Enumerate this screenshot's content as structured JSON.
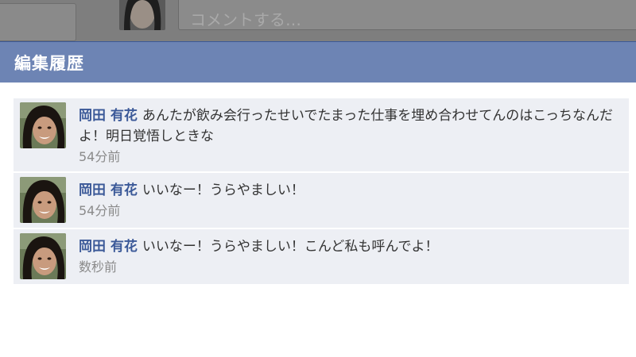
{
  "background": {
    "comment_placeholder": "コメントする…"
  },
  "dialog": {
    "title": "編集履歴"
  },
  "history": [
    {
      "author": "岡田 有花",
      "text": "あんたが飲み会行ったせいでたまった仕事を埋め合わせてんのはこっちなんだよ！明日覚悟しときな",
      "time": "54分前"
    },
    {
      "author": "岡田 有花",
      "text": "いいなー！うらやましい！",
      "time": "54分前"
    },
    {
      "author": "岡田 有花",
      "text": "いいなー！うらやましい！こんど私も呼んでよ！",
      "time": "数秒前"
    }
  ],
  "colors": {
    "header": "#6d84b4",
    "author_link": "#3b5998",
    "item_background": "#edeff4"
  },
  "icons": {
    "avatar": "user-photo-icon"
  }
}
